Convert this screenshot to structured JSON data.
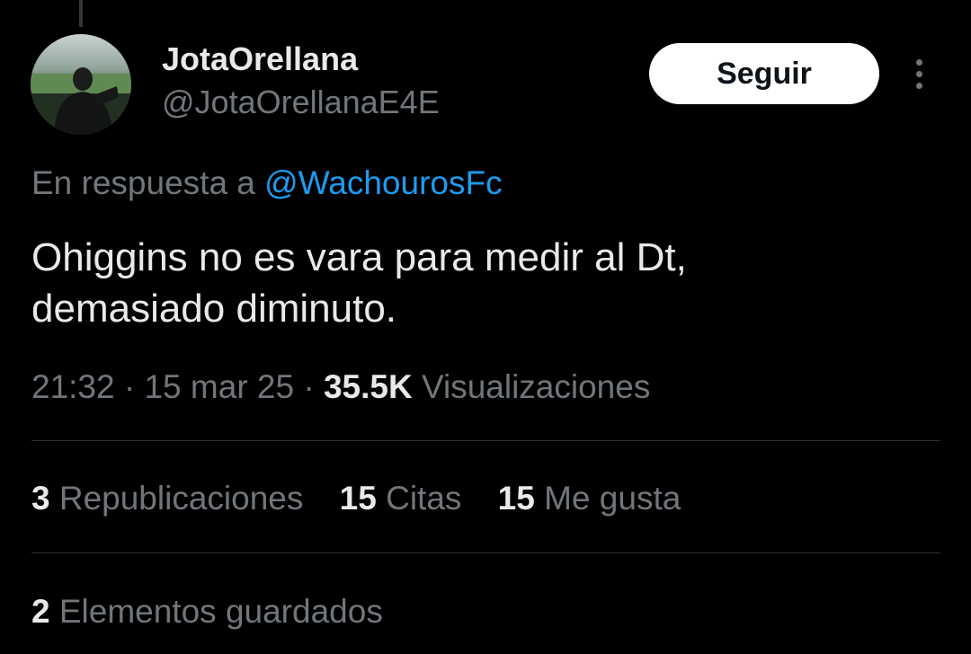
{
  "author": {
    "display_name": "JotaOrellana",
    "handle": "@JotaOrellanaE4E"
  },
  "follow_button": {
    "label": "Seguir"
  },
  "more_icon": "more-vertical-icon",
  "reply": {
    "prefix": "En respuesta a ",
    "mention": "@WachourosFc"
  },
  "tweet": {
    "line1": "Ohiggins no es vara para medir al Dt,",
    "line2": "demasiado diminuto."
  },
  "meta": {
    "time": "21:32",
    "separator": " · ",
    "date": "15 mar 25",
    "views_count": "35.5K",
    "views_label": " Visualizaciones"
  },
  "stats": {
    "reposts_count": "3",
    "reposts_label": " Republicaciones",
    "quotes_count": "15",
    "quotes_label": " Citas",
    "likes_count": "15",
    "likes_label": " Me gusta"
  },
  "bookmarks": {
    "count": "2",
    "label": " Elementos guardados"
  },
  "colors": {
    "background": "#000000",
    "primary_text": "#e7e9ea",
    "secondary_text": "#71767b",
    "link": "#1d9bf0",
    "divider": "#2f3336",
    "button_bg": "#ffffff"
  }
}
